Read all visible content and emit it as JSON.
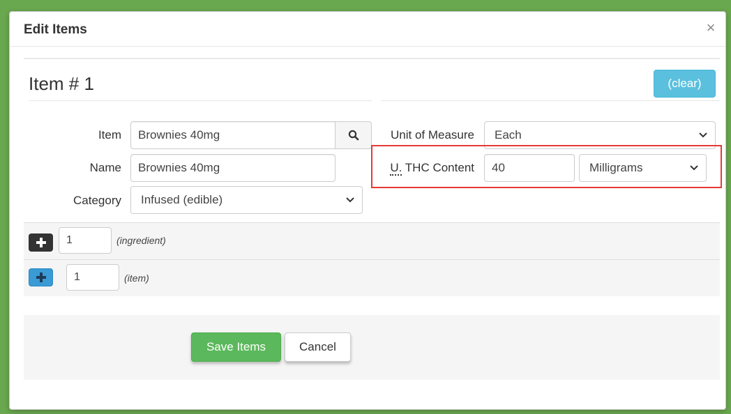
{
  "dialog": {
    "title": "Edit Items",
    "close_symbol": "×"
  },
  "item": {
    "heading": "Item # 1",
    "clear_label": "(clear)"
  },
  "fields": {
    "item_label": "Item",
    "item_value": "Brownies 40mg",
    "name_label": "Name",
    "name_value": "Brownies 40mg",
    "category_label": "Category",
    "category_value": "Infused (edible)",
    "uom_label": "Unit of Measure",
    "uom_value": "Each",
    "thc_label_abbr": "U.",
    "thc_label_rest": " THC Content",
    "thc_value": "40",
    "thc_unit_value": "Milligrams"
  },
  "rows": {
    "ingredient_count": "1",
    "ingredient_hint": "(ingredient)",
    "item_count": "1",
    "item_hint": "(item)"
  },
  "footer": {
    "save_label": "Save Items",
    "cancel_label": "Cancel"
  },
  "icons": {
    "search": "search-icon",
    "chevron": "chevron-down-icon",
    "plus": "plus-icon",
    "close": "close-icon"
  },
  "colors": {
    "frame_green": "#6aa84f",
    "info_blue": "#5bc0de",
    "success_green": "#5cb85c",
    "highlight_red": "#e53935",
    "primary_blue": "#3a9bd5"
  }
}
